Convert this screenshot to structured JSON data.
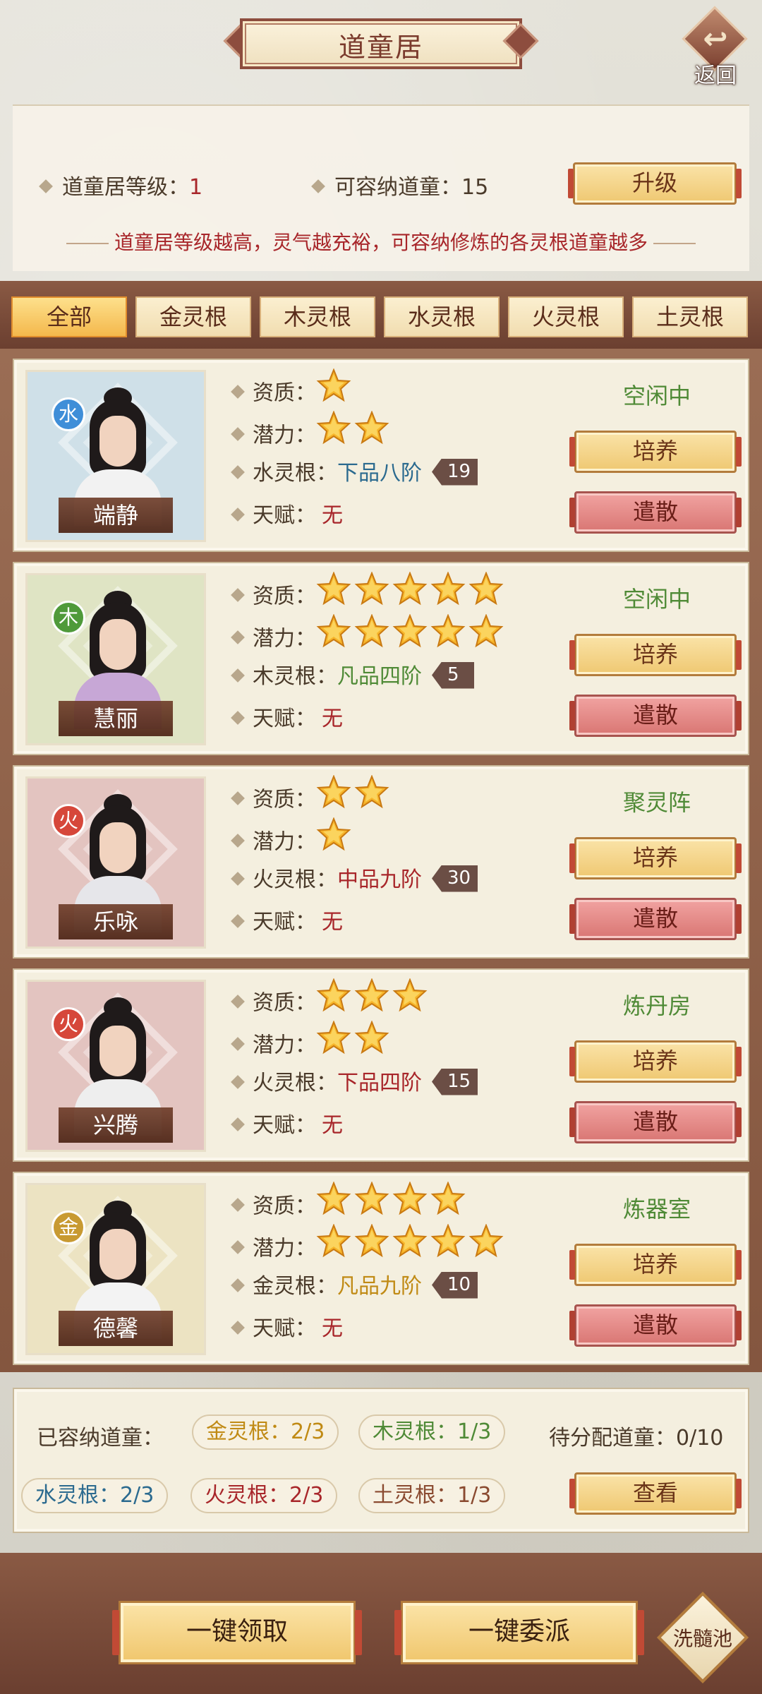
{
  "header": {
    "title": "道童居",
    "back_label": "返回"
  },
  "info": {
    "level_label": "道童居等级：",
    "level_value": "1",
    "capacity_label": "可容纳道童：",
    "capacity_value": "15",
    "upgrade_label": "升级",
    "hint": "道童居等级越高，灵气越充裕，可容纳修炼的各灵根道童越多"
  },
  "tabs": [
    "全部",
    "金灵根",
    "木灵根",
    "水灵根",
    "火灵根",
    "土灵根"
  ],
  "active_tab": "全部",
  "labels": {
    "aptitude": "资质：",
    "potential": "潜力：",
    "talent": "天赋：",
    "train": "培养",
    "dismiss": "遣散"
  },
  "disciples": [
    {
      "element": "水",
      "element_color": "#3f8ed8",
      "bg": "#cfe0e8",
      "robe": "#f2f2f2",
      "name": "端静",
      "aptitude": 1,
      "potential": 2,
      "root_label": "水灵根：",
      "rank": "下品八阶",
      "rank_class": "rank-blue",
      "level": "19",
      "talent": "无",
      "status": "空闲中"
    },
    {
      "element": "木",
      "element_color": "#4f9a3a",
      "bg": "#dfe4c4",
      "robe": "#c7a7d6",
      "name": "慧丽",
      "aptitude": 5,
      "potential": 5,
      "root_label": "木灵根：",
      "rank": "凡品四阶",
      "rank_class": "rank-green",
      "level": "5",
      "talent": "无",
      "status": "空闲中"
    },
    {
      "element": "火",
      "element_color": "#d6473a",
      "bg": "#e3c4c0",
      "robe": "#e6e6ea",
      "name": "乐咏",
      "aptitude": 2,
      "potential": 1,
      "root_label": "火灵根：",
      "rank": "中品九阶",
      "rank_class": "rank-red",
      "level": "30",
      "talent": "无",
      "status": "聚灵阵"
    },
    {
      "element": "火",
      "element_color": "#d6473a",
      "bg": "#e3c4c0",
      "robe": "#eeeeee",
      "name": "兴腾",
      "aptitude": 3,
      "potential": 2,
      "root_label": "火灵根：",
      "rank": "下品四阶",
      "rank_class": "rank-red",
      "level": "15",
      "talent": "无",
      "status": "炼丹房"
    },
    {
      "element": "金",
      "element_color": "#c89a32",
      "bg": "#ece3c2",
      "robe": "#f3f3f3",
      "name": "德馨",
      "aptitude": 4,
      "potential": 5,
      "root_label": "金灵根：",
      "rank": "凡品九阶",
      "rank_class": "rank-gold",
      "level": "10",
      "talent": "无",
      "status": "炼器室"
    }
  ],
  "summary": {
    "capacity_label": "已容纳道童：",
    "gold": "金灵根：2/3",
    "wood": "木灵根：1/3",
    "water": "水灵根：2/3",
    "fire": "火灵根：2/3",
    "earth": "土灵根：1/3",
    "pending": "待分配道童：0/10",
    "view_label": "查看"
  },
  "bottom": {
    "claim_all": "一键领取",
    "dispatch_all": "一键委派",
    "wash_pool": "洗髓池"
  },
  "colors": {
    "accent_red": "#a8262a",
    "status_green": "#4f8a36",
    "frame_brown": "#8a5a44"
  }
}
